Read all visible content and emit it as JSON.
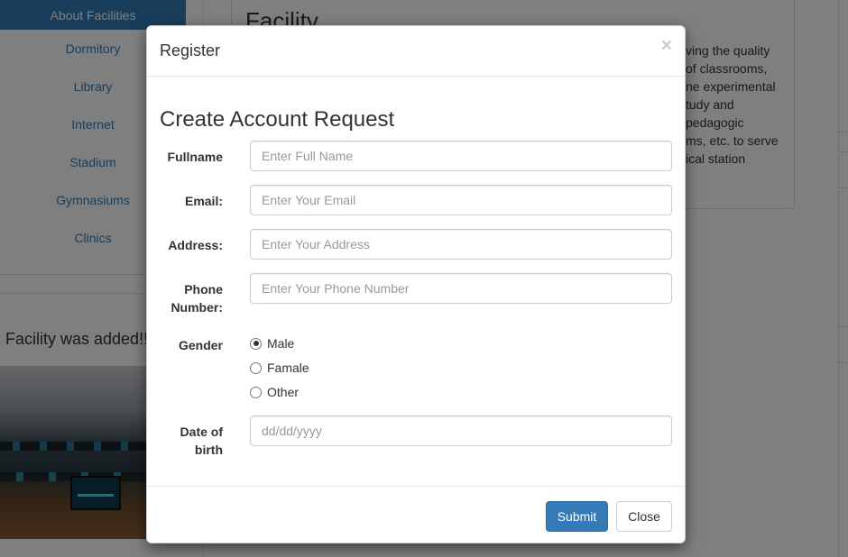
{
  "background": {
    "sidebar": {
      "active_item": "About Facilities",
      "items": [
        "Dormitory",
        "Library",
        "Internet",
        "Stadium",
        "Gymnasiums",
        "Clinics"
      ]
    },
    "added_message": "Facility was added!!",
    "facility": {
      "title": "Facility",
      "text_lines": [
        "ving the quality",
        "of classrooms,",
        "ne experimental",
        "tudy and",
        "pedagogic",
        "ms, etc. to serve",
        "ical station"
      ]
    }
  },
  "modal": {
    "title": "Register",
    "close_symbol": "×",
    "form_heading": "Create Account Request",
    "fields": {
      "fullname": {
        "label": "Fullname",
        "placeholder": "Enter Full Name",
        "value": ""
      },
      "email": {
        "label": "Email:",
        "placeholder": "Enter Your Email",
        "value": ""
      },
      "address": {
        "label": "Address:",
        "placeholder": "Enter Your Address",
        "value": ""
      },
      "phone": {
        "label_line1": "Phone",
        "label_line2": "Number:",
        "placeholder": "Enter Your Phone Number",
        "value": ""
      },
      "dob": {
        "label_line1": "Date of",
        "label_line2": "birth",
        "placeholder": "dd/dd/yyyy",
        "value": ""
      }
    },
    "gender": {
      "label": "Gender",
      "options": [
        "Male",
        "Famale",
        "Other"
      ],
      "selected": "Male"
    },
    "buttons": {
      "submit": "Submit",
      "close": "Close"
    },
    "colors": {
      "primary": "#337ab7",
      "backdrop": "rgba(0,0,0,0.5)"
    }
  }
}
